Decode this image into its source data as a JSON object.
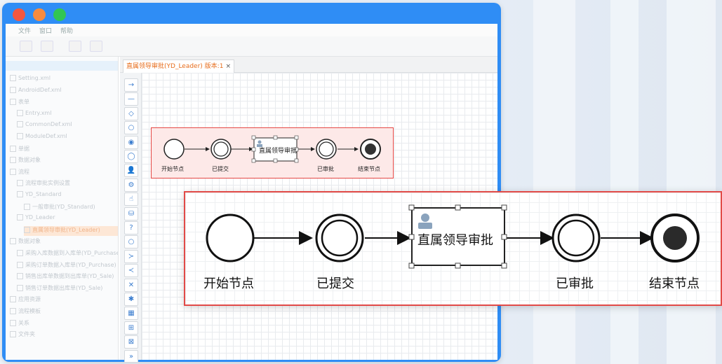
{
  "window": {
    "menu": [
      "文件",
      "窗口",
      "帮助"
    ]
  },
  "tree": {
    "items": [
      {
        "label": "Setting.xml",
        "indent": 0
      },
      {
        "label": "AndroidDef.xml",
        "indent": 0
      },
      {
        "label": "表单",
        "indent": 0
      },
      {
        "label": "Entry.xml",
        "indent": 1
      },
      {
        "label": "CommonDef.xml",
        "indent": 1
      },
      {
        "label": "ModuleDef.xml",
        "indent": 1
      },
      {
        "label": "单据",
        "indent": 0
      },
      {
        "label": "数据对象",
        "indent": 0
      },
      {
        "label": "流程",
        "indent": 0
      },
      {
        "label": "流程审批实例设置",
        "indent": 1
      },
      {
        "label": "YD_Standard",
        "indent": 1
      },
      {
        "label": "一般审批(YD_Standard)",
        "indent": 2
      },
      {
        "label": "YD_Leader",
        "indent": 1
      },
      {
        "label": "直属领导审批(YD_Leader)",
        "indent": 2,
        "selected": true
      },
      {
        "label": "数据对象",
        "indent": 0
      },
      {
        "label": "采购入库数据到入库单(YD_Purchase)",
        "indent": 1
      },
      {
        "label": "采购订单数据入库单(YD_Purchase)",
        "indent": 1
      },
      {
        "label": "销售出库单数据到出库单(YD_Sale)",
        "indent": 1
      },
      {
        "label": "销售订单数据出库单(YD_Sale)",
        "indent": 1
      },
      {
        "label": "应用资源",
        "indent": 0
      },
      {
        "label": "流程模板",
        "indent": 0
      },
      {
        "label": "关系",
        "indent": 0
      },
      {
        "label": "文件夹",
        "indent": 0
      }
    ]
  },
  "editor": {
    "tab_label": "直属领导审批(YD_Leader) 版本:1",
    "tab_close": "×"
  },
  "palette": [
    "→",
    "—",
    "◇",
    "○",
    "◉",
    "◯",
    "👤",
    "⚙",
    "☝",
    "⛁",
    "?",
    "○",
    "≻",
    "≺",
    "✕",
    "✱",
    "▦",
    "⊞",
    "⊠",
    "»"
  ],
  "flow": {
    "nodes": {
      "start": "开始节点",
      "submitted": "已提交",
      "task": "直属领导审批",
      "approved": "已审批",
      "end": "结束节点"
    }
  },
  "colors": {
    "titlebar": "#2f8df5",
    "highlight_border": "#e54845",
    "highlight_fill": "#fde9e8",
    "tab_text": "#e76d1c"
  }
}
